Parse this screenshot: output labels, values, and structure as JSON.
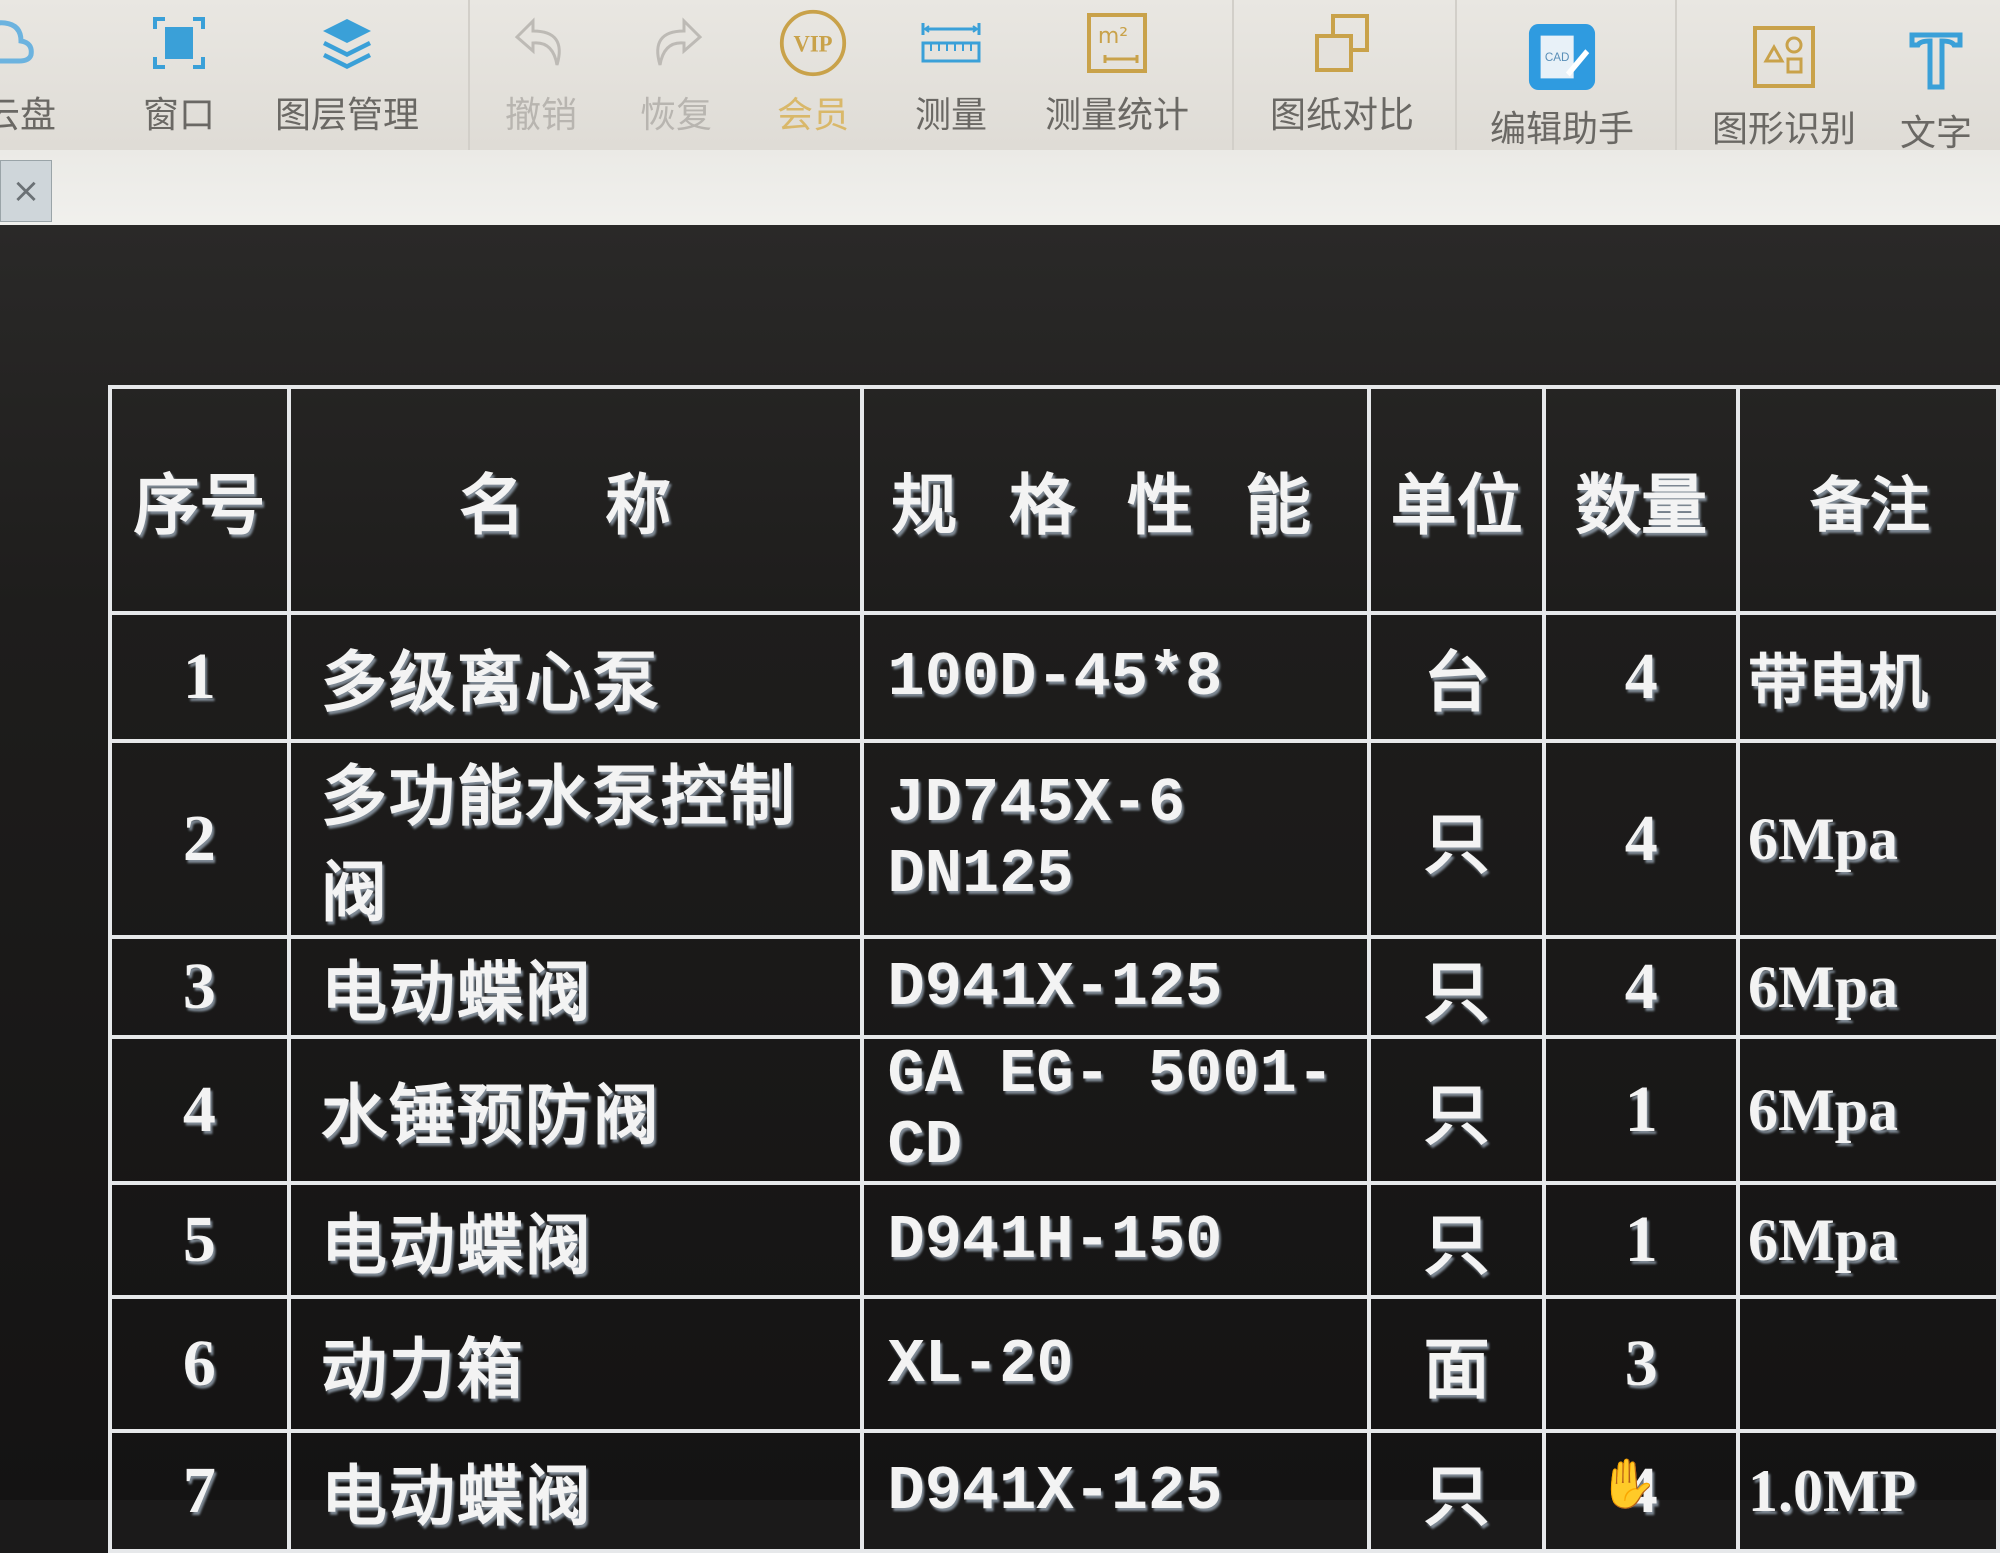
{
  "toolbar": {
    "items": [
      {
        "label": "看云盘",
        "icon": "cloud-disk-icon",
        "state": "normal"
      },
      {
        "label": "窗口",
        "icon": "window-icon",
        "state": "normal"
      },
      {
        "label": "图层管理",
        "icon": "layers-icon",
        "state": "normal"
      },
      {
        "label": "撤销",
        "icon": "undo-icon",
        "state": "disabled"
      },
      {
        "label": "恢复",
        "icon": "redo-icon",
        "state": "disabled"
      },
      {
        "label": "会员",
        "icon": "vip-icon",
        "state": "vip"
      },
      {
        "label": "测量",
        "icon": "measure-icon",
        "state": "normal"
      },
      {
        "label": "测量统计",
        "icon": "measure-stats-icon",
        "state": "normal"
      },
      {
        "label": "图纸对比",
        "icon": "drawing-compare-icon",
        "state": "normal"
      },
      {
        "label": "编辑助手",
        "icon": "cad-edit-assistant-icon",
        "state": "normal"
      },
      {
        "label": "图形识别",
        "icon": "shape-recognition-icon",
        "state": "normal"
      },
      {
        "label": "文字",
        "icon": "text-icon",
        "state": "normal"
      }
    ],
    "vip_icon_text": "VIP",
    "cad_icon_text": "CAD"
  },
  "tabstrip": {
    "close_glyph": "×"
  },
  "table": {
    "headers": [
      "序号",
      "名称",
      "规格性能",
      "单位",
      "数量",
      "备注"
    ],
    "rows": [
      {
        "idx": "1",
        "name": "多级离心泵",
        "spec": "100D-45*8",
        "unit": "台",
        "qty": "4",
        "note": "带电机"
      },
      {
        "idx": "2",
        "name": "多功能水泵控制阀",
        "spec": "JD745X-6 DN125",
        "unit": "只",
        "qty": "4",
        "note": "6Mpa"
      },
      {
        "idx": "3",
        "name": "电动蝶阀",
        "spec": "D941X-125",
        "unit": "只",
        "qty": "4",
        "note": "6Mpa"
      },
      {
        "idx": "4",
        "name": "水锤预防阀",
        "spec": "GA EG- 5001-CD",
        "unit": "只",
        "qty": "1",
        "note": "6Mpa"
      },
      {
        "idx": "5",
        "name": "电动蝶阀",
        "spec": "D941H-150",
        "unit": "只",
        "qty": "1",
        "note": "6Mpa"
      },
      {
        "idx": "6",
        "name": "动力箱",
        "spec": "XL-20",
        "unit": "面",
        "qty": "3",
        "note": ""
      },
      {
        "idx": "7",
        "name": "电动蝶阀",
        "spec": "D941X-125",
        "unit": "只",
        "qty": "4",
        "note": "1.0MP"
      }
    ]
  },
  "colors": {
    "toolbar_icon_blue": "#3aa0d8",
    "toolbar_icon_gold": "#c9a24a",
    "canvas_bg": "#1b1a1a",
    "table_line": "#e6e8ea"
  }
}
